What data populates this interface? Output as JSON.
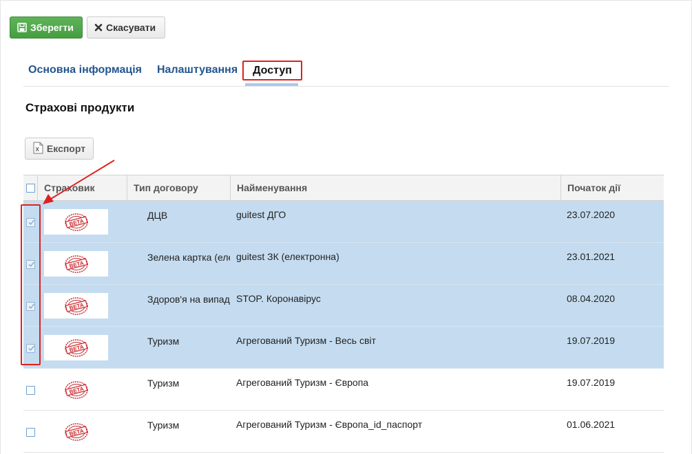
{
  "toolbar": {
    "save_label": "Зберегти",
    "cancel_label": "Скасувати"
  },
  "tabs": [
    {
      "label": "Основна інформація",
      "active": false
    },
    {
      "label": "Налаштування",
      "active": false
    },
    {
      "label": "Доступ",
      "active": true
    }
  ],
  "section": {
    "title": "Страхові продукти",
    "export_label": "Експорт"
  },
  "table": {
    "columns": [
      "Страховик",
      "Тип договору",
      "Найменування",
      "Початок дії"
    ],
    "rows": [
      {
        "checked": true,
        "insurer_logo": "BETA",
        "type": "ДЦВ",
        "name": "guitest ДГО",
        "start": "23.07.2020"
      },
      {
        "checked": true,
        "insurer_logo": "BETA",
        "type": "Зелена картка (електронна)",
        "name": "guitest ЗК (електронна)",
        "start": "23.01.2021"
      },
      {
        "checked": true,
        "insurer_logo": "BETA",
        "type": "Здоров'я на випадок",
        "name": "STOP. Коронавірус",
        "start": "08.04.2020"
      },
      {
        "checked": true,
        "insurer_logo": "BETA",
        "type": "Туризм",
        "name": "Агрегований Туризм - Весь світ",
        "start": "19.07.2019"
      },
      {
        "checked": false,
        "insurer_logo": "BETA",
        "type": "Туризм",
        "name": "Агрегований Туризм - Європа",
        "start": "19.07.2019"
      },
      {
        "checked": false,
        "insurer_logo": "BETA",
        "type": "Туризм",
        "name": "Агрегований Туризм - Європа_id_паспорт",
        "start": "01.06.2021"
      }
    ]
  },
  "icons": {
    "save": "floppy-disk-icon",
    "cancel": "close-icon",
    "export": "excel-file-icon",
    "checkbox_check": "check-icon"
  },
  "colors": {
    "save_button": "#4ea849",
    "link": "#23558f",
    "selected_row": "#c5dcf0",
    "annotation": "#e02020",
    "logo_red": "#c8282d"
  }
}
